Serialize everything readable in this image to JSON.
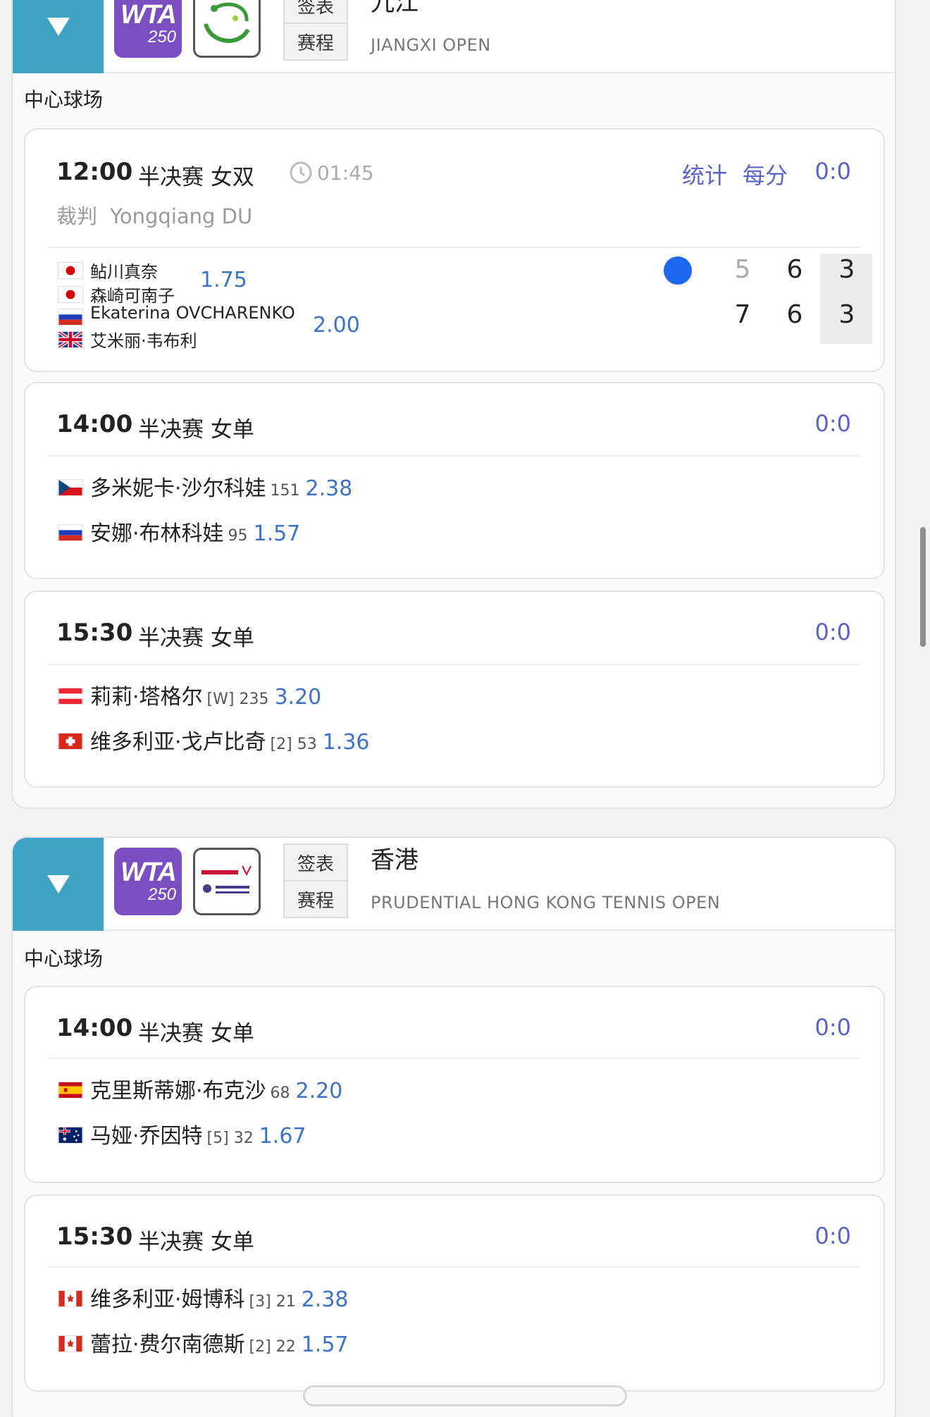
{
  "tournaments": [
    {
      "city": "九江",
      "name": "JIANGXI OPEN",
      "draw_label": "签表",
      "schedule_label": "赛程",
      "wta_label": "WTA",
      "wta_level": "250",
      "event_logo": "jiangxi-open-logo",
      "court": "中心球场",
      "matches": [
        {
          "time": "12:00",
          "round": "半决赛 女双",
          "duration": "01:45",
          "stats_label": "统计",
          "per_point_label": "每分",
          "score": "0:0",
          "referee_label": "裁判",
          "referee": "Yongqiang DU",
          "team1": {
            "players": [
              {
                "flag": "japan",
                "name": "鲇川真奈"
              },
              {
                "flag": "japan",
                "name": "森崎可南子"
              }
            ],
            "odds": "1.75",
            "sets": [
              "5",
              "6",
              "3"
            ],
            "serving": true
          },
          "team2": {
            "players": [
              {
                "flag": "russia",
                "name": "Ekaterina OVCHARENKO"
              },
              {
                "flag": "uk",
                "name": "艾米丽·韦布利"
              }
            ],
            "odds": "2.00",
            "sets": [
              "7",
              "6",
              "3"
            ]
          }
        },
        {
          "time": "14:00",
          "round": "半决赛 女单",
          "score": "0:0",
          "player1": {
            "flag": "czech",
            "name": "多米妮卡·沙尔科娃",
            "seed": "151",
            "odds": "2.38"
          },
          "player2": {
            "flag": "russia",
            "name": "安娜·布林科娃",
            "seed": "95",
            "odds": "1.57"
          }
        },
        {
          "time": "15:30",
          "round": "半决赛 女单",
          "score": "0:0",
          "player1": {
            "flag": "austria",
            "name": "莉莉·塔格尔",
            "seed": "[W] 235",
            "odds": "3.20"
          },
          "player2": {
            "flag": "switzerland",
            "name": "维多利亚·戈卢比奇",
            "seed": "[2] 53",
            "odds": "1.36"
          }
        }
      ]
    },
    {
      "city": "香港",
      "name": "PRUDENTIAL HONG KONG TENNIS OPEN",
      "draw_label": "签表",
      "schedule_label": "赛程",
      "wta_label": "WTA",
      "wta_level": "250",
      "event_logo": "prudential-hong-kong-open-logo",
      "court": "中心球场",
      "matches": [
        {
          "time": "14:00",
          "round": "半决赛 女单",
          "score": "0:0",
          "player1": {
            "flag": "spain",
            "name": "克里斯蒂娜·布克沙",
            "seed": "68",
            "odds": "2.20"
          },
          "player2": {
            "flag": "australia",
            "name": "马娅·乔因特",
            "seed": "[5] 32",
            "odds": "1.67"
          }
        },
        {
          "time": "15:30",
          "round": "半决赛 女单",
          "score": "0:0",
          "player1": {
            "flag": "canada",
            "name": "维多利亚·姆博科",
            "seed": "[3] 21",
            "odds": "2.38"
          },
          "player2": {
            "flag": "canada",
            "name": "蕾拉·费尔南德斯",
            "seed": "[2] 22",
            "odds": "1.57"
          }
        }
      ]
    }
  ],
  "colors": {
    "accent": "#3da2c3",
    "wta_purple": "#7b4fc1",
    "link": "#5a63c8",
    "odds": "#3d72c9",
    "serve_dot": "#1d66f0"
  }
}
